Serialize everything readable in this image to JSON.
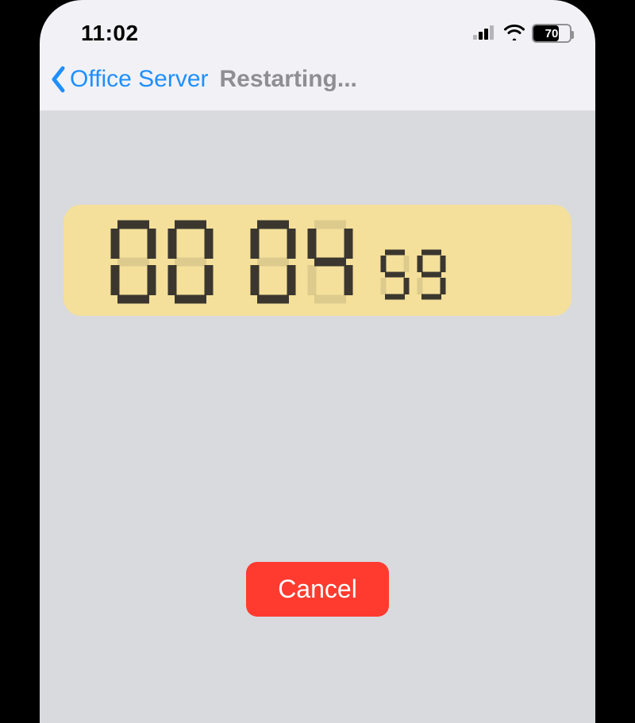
{
  "status_bar": {
    "time": "11:02",
    "battery_percent": "70"
  },
  "nav": {
    "back_label": "Office Server",
    "title": "Restarting..."
  },
  "timer": {
    "hours": "00",
    "minutes": "04",
    "seconds": "59"
  },
  "actions": {
    "cancel_label": "Cancel"
  }
}
